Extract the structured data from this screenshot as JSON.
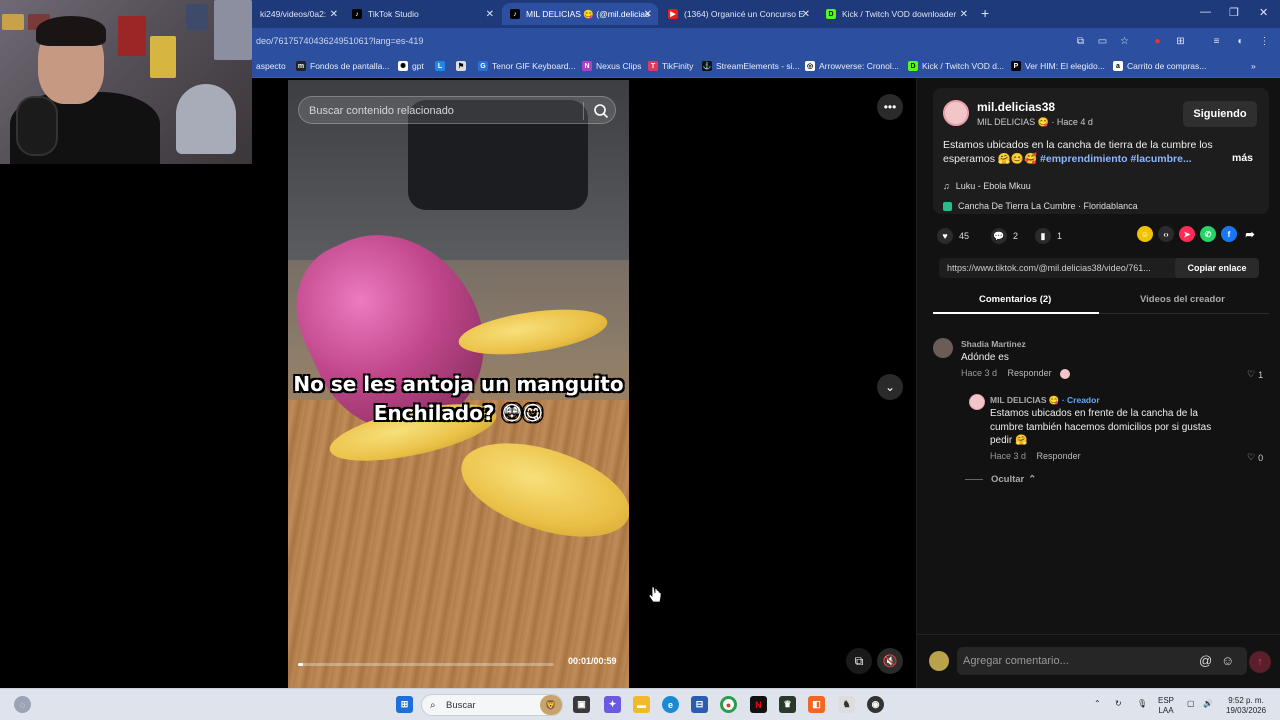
{
  "browser": {
    "tabs": [
      {
        "title": "ki249/videos/0a2:",
        "active": false
      },
      {
        "title": "TikTok Studio",
        "active": false
      },
      {
        "title": "MIL DELICIAS 😋 (@mil.delicias",
        "active": true
      },
      {
        "title": "(1364) Organicé un Concurso E",
        "active": false
      },
      {
        "title": "Kick / Twitch VOD downloader",
        "active": false
      }
    ],
    "url": "deo/7617574043624951061?lang=es-419",
    "bookmarks": [
      "aspecto",
      "Fondos de pantalla...",
      "gpt",
      "L",
      "",
      "Tenor GIF Keyboard...",
      "Nexus Clips",
      "TikFinity",
      "StreamElements - si...",
      "Arrowverse: Cronol...",
      "Kick / Twitch VOD d...",
      "Ver HIM: El elegido...",
      "Carrito de compras..."
    ]
  },
  "video": {
    "search_placeholder": "Buscar contenido relacionado",
    "caption_line1": "No se les antoja un manguito",
    "caption_line2": "Enchilado? 😳😋",
    "timecode": "00:01/00:59",
    "progress_fraction": 0.02
  },
  "post": {
    "username": "mil.delicias38",
    "display_name": "MIL DELICIAS 😋",
    "time_ago": "Hace 4 d",
    "follow_label": "Siguiendo",
    "description_text": "Estamos ubicados en la cancha de tierra de la cumbre los esperamos 🤗😊🥰",
    "hashtags": "#emprendimiento #lacumbre...",
    "more_label": "más",
    "music": "Luku - Ebola Mkuu",
    "location": "Cancha De Tierra La Cumbre · Floridablanca",
    "likes": "45",
    "comments_count": "2",
    "saves": "1",
    "link": "https://www.tiktok.com/@mil.delicias38/video/761...",
    "copy_label": "Copiar enlace"
  },
  "comment_tabs": {
    "comments": "Comentarios (2)",
    "creator_videos": "Videos del creador"
  },
  "comments": [
    {
      "author": "Shadia Martinez",
      "text": "Adónde es",
      "time": "Hace 3 d",
      "reply_label": "Responder",
      "likes": "1"
    },
    {
      "author": "MIL DELICIAS 😋",
      "creator_label": "· Creador",
      "text": "Estamos ubicados en frente de la cancha de la cumbre también hacemos domicilios por si gustas pedir 🤗",
      "time": "Hace 3 d",
      "reply_label": "Responder",
      "likes": "0"
    }
  ],
  "hide_label": "Ocultar",
  "comment_input_placeholder": "Agregar comentario...",
  "taskbar": {
    "search_label": "Buscar",
    "lang_line1": "ESP",
    "lang_line2": "LAA",
    "time": "9:52 p. m.",
    "date": "19/03/2026"
  },
  "colors": {
    "tabbar": "#1f3a7a",
    "addressbar": "#2c4fa0",
    "panel_bg": "#121212",
    "link_blue": "#8fb6ff",
    "creator_blue": "#6aa7ff"
  }
}
